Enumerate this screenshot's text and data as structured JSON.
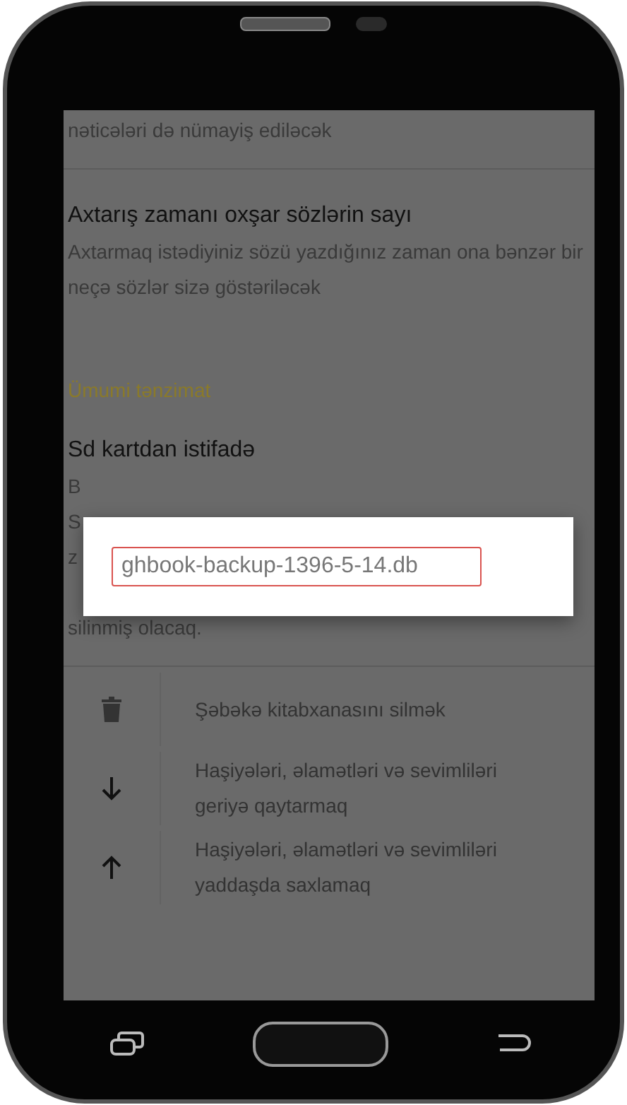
{
  "top_text": "nəticələri də nümayiş ediləcək",
  "similar_words": {
    "title": "Axtarış zamanı oxşar sözlərin sayı",
    "description": "Axtarmaq istədiyiniz sözü yazdığınız zaman ona bənzər bir neçə sözlər sizə göstəriləcək"
  },
  "section_header": "Ümumi tənzimat",
  "sd_card": {
    "title": "Sd kartdan istifadə",
    "description_lines": [
      "B",
      "S",
      "z",
      "silinmiş olacaq."
    ]
  },
  "dialog": {
    "value": "ghbook-backup-1396-5-14.db"
  },
  "actions": [
    {
      "kind": "delete",
      "label": "Şəbəkə kitabxanasını silmək"
    },
    {
      "kind": "restore",
      "label": "Haşiyələri, əlamətləri və sevimliləri geriyə qaytarmaq"
    },
    {
      "kind": "backup",
      "label": "Haşiyələri, əlamətləri və sevimliləri yaddaşda saxlamaq"
    }
  ]
}
